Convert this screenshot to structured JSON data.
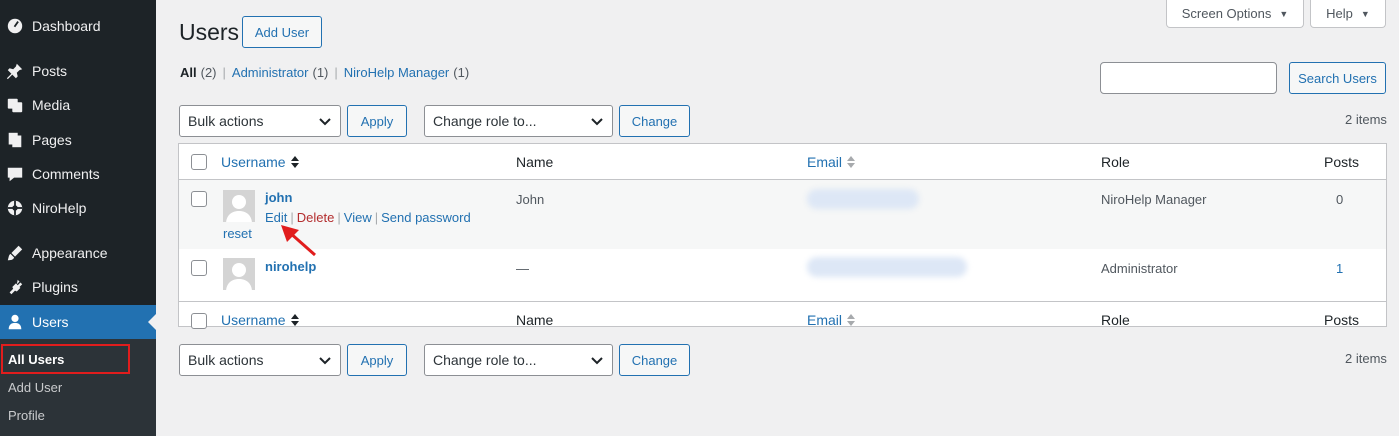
{
  "sidebar": {
    "items": [
      {
        "label": "Dashboard",
        "icon": "dashboard-icon"
      },
      {
        "label": "Posts",
        "icon": "pin-icon"
      },
      {
        "label": "Media",
        "icon": "media-icon"
      },
      {
        "label": "Pages",
        "icon": "pages-icon"
      },
      {
        "label": "Comments",
        "icon": "comments-icon"
      },
      {
        "label": "NiroHelp",
        "icon": "nirohelp-icon"
      },
      {
        "label": "Appearance",
        "icon": "appearance-icon"
      },
      {
        "label": "Plugins",
        "icon": "plugins-icon"
      },
      {
        "label": "Users",
        "icon": "users-icon"
      }
    ],
    "submenu": [
      "All Users",
      "Add User",
      "Profile"
    ]
  },
  "top": {
    "screen_options": "Screen Options",
    "help": "Help"
  },
  "header": {
    "title": "Users",
    "add_user": "Add User"
  },
  "views": {
    "all": {
      "label": "All",
      "count": "(2)"
    },
    "administrator": {
      "label": "Administrator",
      "count": "(1)"
    },
    "nirohelp_manager": {
      "label": "NiroHelp Manager",
      "count": "(1)"
    },
    "separator": "|"
  },
  "search": {
    "button": "Search Users",
    "value": ""
  },
  "bulk": {
    "label": "Bulk actions",
    "apply": "Apply",
    "role": "Change role to...",
    "change": "Change"
  },
  "items_count": "2 items",
  "table": {
    "headers": {
      "username": "Username",
      "name": "Name",
      "email": "Email",
      "role": "Role",
      "posts": "Posts"
    },
    "rows": [
      {
        "username": "john",
        "name": "John",
        "role": "NiroHelp Manager",
        "posts": "0",
        "actions": {
          "edit": "Edit",
          "delete": "Delete",
          "view": "View",
          "send": "Send password",
          "reset": "reset"
        }
      },
      {
        "username": "nirohelp",
        "name": "—",
        "role": "Administrator",
        "posts": "1"
      }
    ]
  },
  "colors": {
    "accent": "#2271b1",
    "sidebar_bg": "#1d2327",
    "delete": "#b32d2e",
    "annotation": "#e11d1d"
  }
}
